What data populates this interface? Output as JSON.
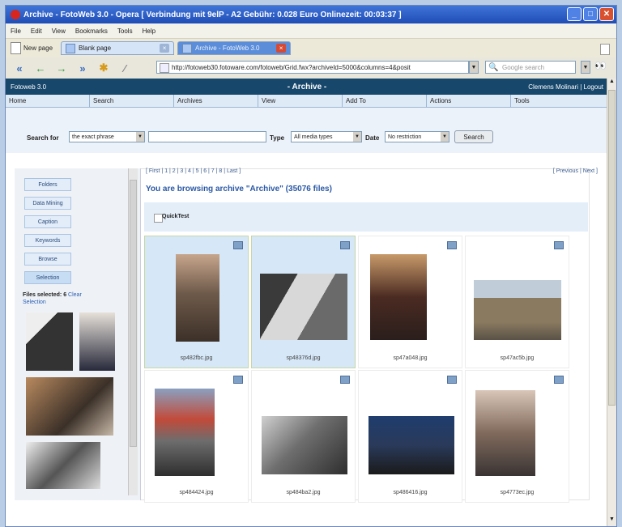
{
  "window": {
    "title": "Archive - FotoWeb 3.0 - Opera [ Verbindung mit 9elP - A2 Gebühr: 0.028 Euro Onlinezeit: 00:03:37 ]"
  },
  "menubar": [
    "File",
    "Edit",
    "View",
    "Bookmarks",
    "Tools",
    "Help"
  ],
  "tabs": {
    "new_page_label": "New page",
    "items": [
      {
        "label": "Blank page",
        "active": false
      },
      {
        "label": "Archive - FotoWeb 3.0",
        "active": true
      }
    ]
  },
  "nav": {
    "address": "http://fotoweb30.fotoware.com/fotoweb/Grid.fwx?archiveId=5000&columns=4&posit",
    "search_placeholder": "Google search"
  },
  "app": {
    "brand": "Fotoweb 3.0",
    "title": "- Archive -",
    "user": "Clemens Molinari | Logout",
    "menu": [
      "Home",
      "Search",
      "Archives",
      "View",
      "Add To",
      "Actions",
      "Tools"
    ]
  },
  "search": {
    "label": "Search for",
    "phrase": "the exact phrase",
    "type_label": "Type",
    "type_value": "All media types",
    "date_label": "Date",
    "date_value": "No restriction",
    "button": "Search"
  },
  "sidebar": {
    "buttons": [
      "Folders",
      "Data Mining",
      "Caption",
      "Keywords",
      "Browse",
      "Selection"
    ],
    "files_selected": "Files selected: 6",
    "clear": "Clear",
    "selection_word": "Selection"
  },
  "pagination": {
    "pages": "[ First | 1 | 2 | 3 | 4 | 5 | 6 | 7 | 8 | Last ]",
    "prev_next": "[ Previous | Next ]"
  },
  "browsing": "You are browsing archive \"Archive\" (35076 files)",
  "quicktest": "QuickTest",
  "files": [
    {
      "name": "sp482fbc.jpg",
      "selected": true,
      "img_color": "#6e5a4a"
    },
    {
      "name": "sp48376d.jpg",
      "selected": true,
      "img_color": "#8a8a8a"
    },
    {
      "name": "sp47a048.jpg",
      "selected": false,
      "img_color": "#a07050"
    },
    {
      "name": "sp47ac5b.jpg",
      "selected": false,
      "img_color": "#a09070"
    },
    {
      "name": "sp484424.jpg",
      "selected": false,
      "img_color": "#667788"
    },
    {
      "name": "sp484ba2.jpg",
      "selected": false,
      "img_color": "#6e6e6e"
    },
    {
      "name": "sp486416.jpg",
      "selected": false,
      "img_color": "#2a3a5a"
    },
    {
      "name": "sp4773ec.jpg",
      "selected": false,
      "img_color": "#806a5c"
    }
  ]
}
